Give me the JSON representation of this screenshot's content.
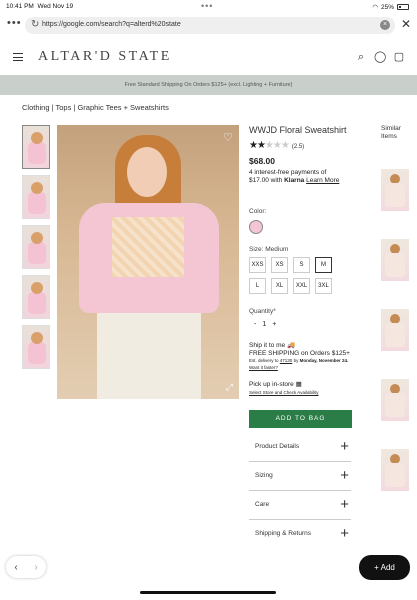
{
  "status": {
    "time": "10:41 PM",
    "date": "Wed Nov 19",
    "battery": "25%"
  },
  "browser": {
    "url": "https://google.com/search?q=alterd%20state"
  },
  "site": {
    "logo": "ALTAR'D STATE",
    "promo": "Free Standard Shipping On Orders $125+ (excl. Lighting + Furniture)"
  },
  "breadcrumb": "Clothing | Tops | Graphic Tees + Sweatshirts",
  "product": {
    "title": "WWJD Floral Sweatshirt",
    "rating_text": "(2.5)",
    "price": "$68.00",
    "klarna_1": "4 interest-free payments of",
    "klarna_2": "$17.00 with",
    "klarna_brand": "Klarna",
    "klarna_link": "Learn More",
    "color_label": "Color:",
    "size_label": "Size: Medium",
    "sizes": [
      "XXS",
      "XS",
      "S",
      "M",
      "L",
      "XL",
      "XXL",
      "3XL"
    ],
    "selected_size": "M",
    "qty_label": "Quantity*",
    "qty_minus": "-",
    "qty_value": "1",
    "qty_plus": "+",
    "ship_title": "Ship it to me",
    "ship_free": "FREE SHIPPING on Orders $125+",
    "ship_est_1": "Est. delivery to",
    "ship_zip": "47130",
    "ship_est_2": "by",
    "ship_date": "Monday, November 24.",
    "ship_faster": "Want it faster?",
    "pickup_title": "Pick up in-store",
    "pickup_link": "Select Store and Check Availability",
    "add_to_bag": "ADD TO BAG",
    "accordions": [
      "Product Details",
      "Sizing",
      "Care",
      "Shipping & Returns"
    ]
  },
  "similar": {
    "title": "Similar Items"
  },
  "bottom": {
    "add_label": "+ Add"
  }
}
